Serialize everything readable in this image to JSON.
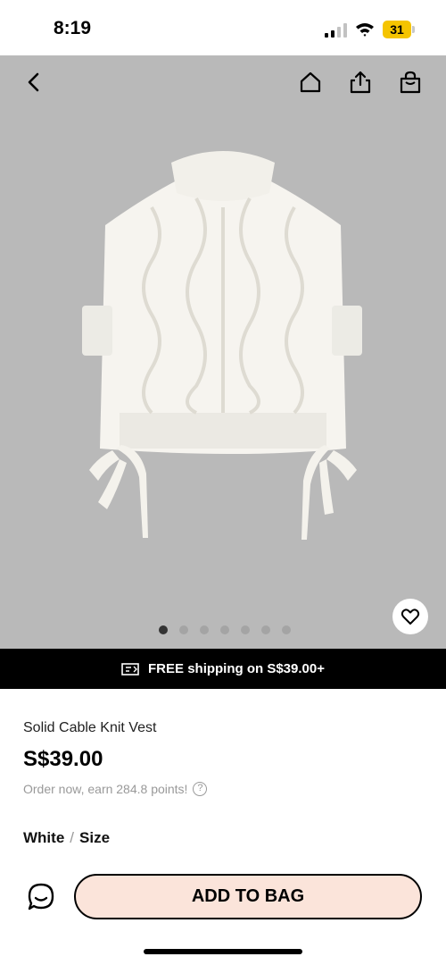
{
  "status_bar": {
    "time": "8:19",
    "battery": "31"
  },
  "hero": {
    "image_alt": "white cable knit vest product photo",
    "dot_count": 7,
    "active_dot": 0
  },
  "icons": {
    "back": "chevron-left-icon",
    "home": "home-icon",
    "share": "share-icon",
    "bag": "shopping-bag-icon",
    "wishlist": "heart-icon",
    "shipping": "truck-icon",
    "help": "question-icon",
    "chat": "chat-icon"
  },
  "shipping_banner": {
    "text": "FREE shipping on S$39.00+"
  },
  "product": {
    "name": "Solid Cable Knit Vest",
    "price": "S$39.00",
    "points_text": "Order now, earn 284.8 points!",
    "help_glyph": "?",
    "color": "White",
    "separator": "/",
    "size_label": "Size"
  },
  "bottom_bar": {
    "add_to_bag": "ADD TO BAG"
  },
  "colors": {
    "hero_bg": "#b9b9b9",
    "banner_bg": "#000000",
    "add_bag_bg": "#fbe4da",
    "battery": "#f5c400"
  }
}
